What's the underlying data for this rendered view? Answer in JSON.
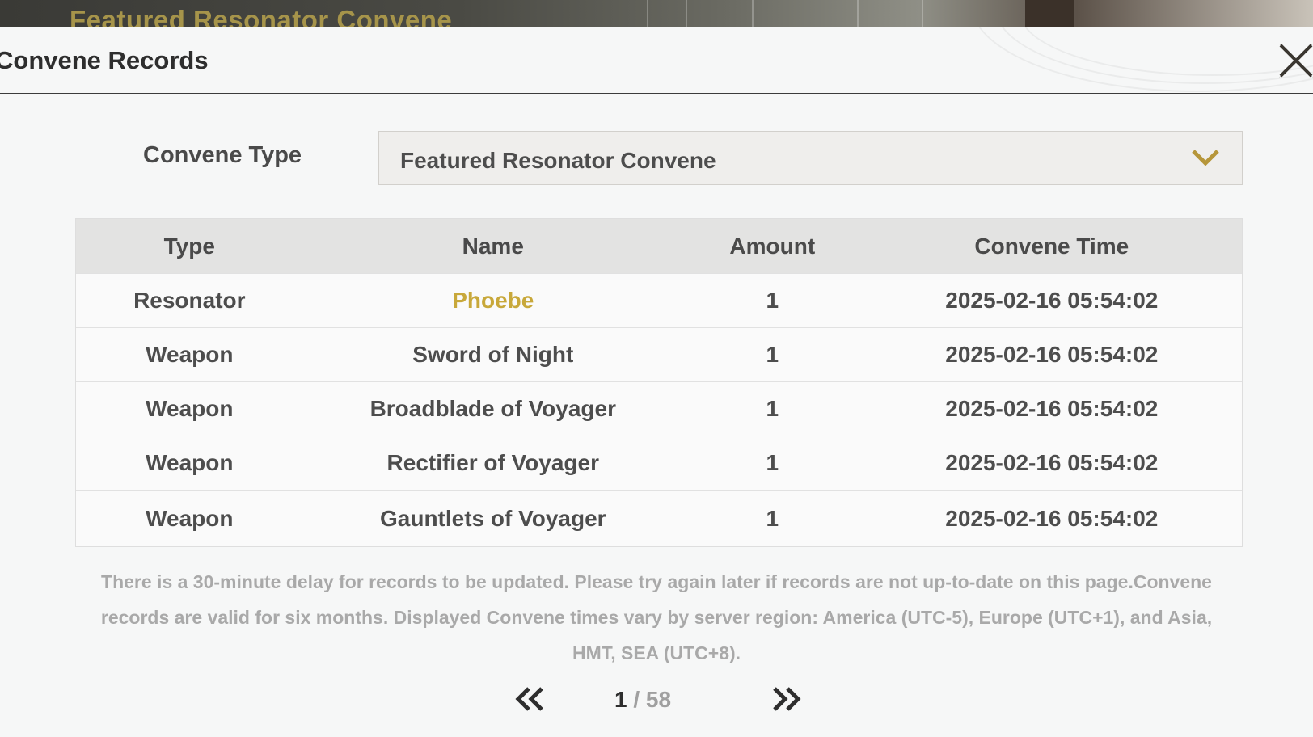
{
  "background": {
    "banner_title": "Featured Resonator Convene"
  },
  "header": {
    "title": "Convene Records"
  },
  "filter": {
    "label": "Convene Type",
    "selected": "Featured Resonator Convene"
  },
  "table": {
    "columns": [
      "Type",
      "Name",
      "Amount",
      "Convene Time"
    ],
    "rows": [
      {
        "type": "Resonator",
        "name": "Phoebe",
        "amount": "1",
        "time": "2025-02-16 05:54:02",
        "highlight": "#c8a83a"
      },
      {
        "type": "Weapon",
        "name": "Sword of Night",
        "amount": "1",
        "time": "2025-02-16 05:54:02"
      },
      {
        "type": "Weapon",
        "name": "Broadblade of Voyager",
        "amount": "1",
        "time": "2025-02-16 05:54:02"
      },
      {
        "type": "Weapon",
        "name": "Rectifier of Voyager",
        "amount": "1",
        "time": "2025-02-16 05:54:02"
      },
      {
        "type": "Weapon",
        "name": "Gauntlets of Voyager",
        "amount": "1",
        "time": "2025-02-16 05:54:02"
      }
    ]
  },
  "notice": "There is a 30-minute delay for records to be updated. Please try again later if records are not up-to-date on this page.Convene records are valid for six months. Displayed Convene times vary by server region: America (UTC-5), Europe (UTC+1), and Asia, HMT, SEA (UTC+8).",
  "pagination": {
    "current": "1",
    "separator": " / ",
    "total": "58"
  },
  "colors": {
    "accent_gold": "#c8a83a",
    "text_dark": "#2e2e2e",
    "notice_gray": "#a9a9a9"
  },
  "icons": {
    "close": "close-x-icon",
    "dropdown": "chevron-down-icon",
    "prev": "double-chevron-left-icon",
    "next": "double-chevron-right-icon"
  }
}
